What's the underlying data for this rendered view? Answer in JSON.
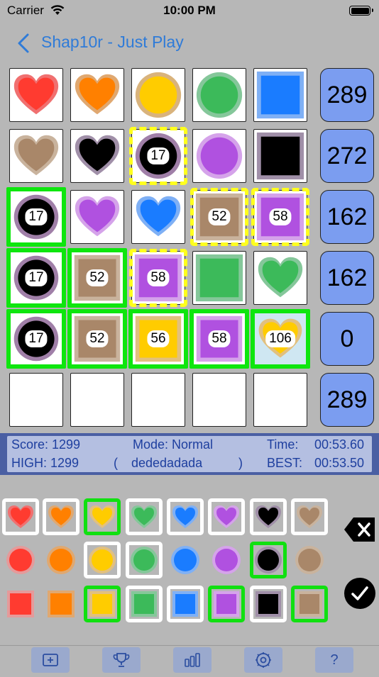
{
  "status_bar": {
    "carrier": "Carrier",
    "time": "10:00 PM"
  },
  "nav": {
    "title": "Shap10r - Just Play"
  },
  "row_scores": [
    "289",
    "272",
    "162",
    "162",
    "0",
    "289"
  ],
  "cell_numbers": {
    "r1c2": "17",
    "r2c0": "17",
    "r2c3": "52",
    "r2c4": "58",
    "r3c0": "17",
    "r3c1": "52",
    "r3c2": "58",
    "r4c0": "17",
    "r4c1": "52",
    "r4c2": "56",
    "r4c3": "58",
    "r4c4": "106"
  },
  "score": {
    "score_label": "Score: 1299",
    "high_label": "HIGH: 1299",
    "mode_label": "Mode: Normal",
    "seed_open": "(",
    "seed": "dededadada",
    "seed_close": ")",
    "time_label": "Time:",
    "time_value": "00:53.60",
    "best_label": "BEST:",
    "best_value": "00:53.50"
  },
  "colors": {
    "red": "#ff4040",
    "orange": "#ff8000",
    "yellow": "#ffcc00",
    "green": "#3cba5a",
    "blue": "#1a7cff",
    "purple": "#b051e0",
    "black": "#000000",
    "brown": "#a98769",
    "selection_green": "#0ee60e",
    "selection_yellow": "#ffff1e"
  },
  "toolbar": {
    "icons": [
      "add-icon",
      "trophy-icon",
      "stats-icon",
      "settings-icon"
    ],
    "help": "?"
  }
}
